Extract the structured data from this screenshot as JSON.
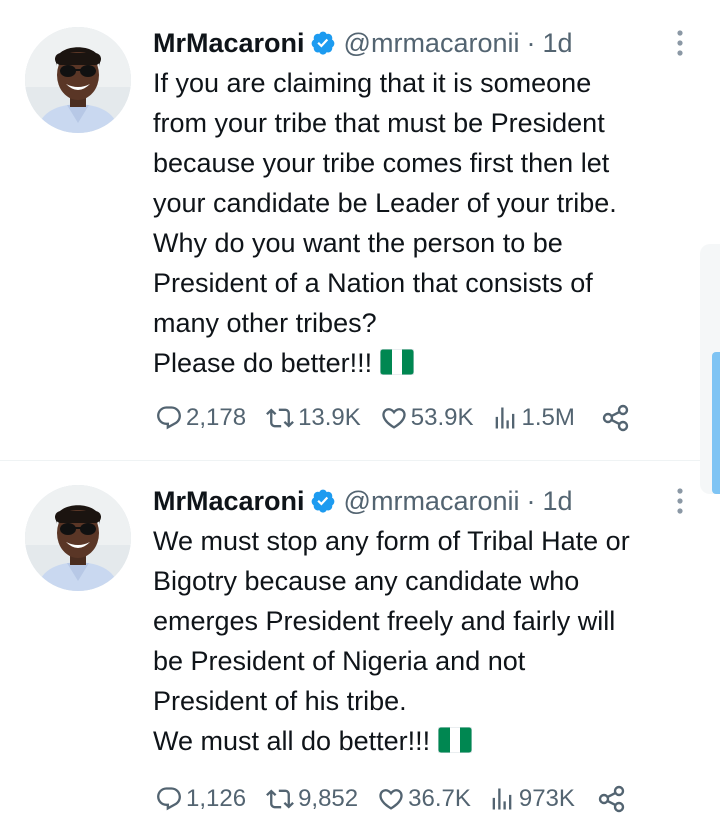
{
  "tweets": [
    {
      "author": {
        "name": "MrMacaroni",
        "handle": "@mrmacaronii",
        "time": "1d",
        "separator": "·"
      },
      "lines": [
        "If you are claiming that it is someone",
        "from your tribe that must be President",
        "because your tribe comes first then let",
        "your candidate be Leader of your tribe.",
        "Why do you want the person to be",
        "President of a Nation that consists of",
        "many other tribes?",
        "Please do better!!!"
      ],
      "stats": {
        "replies": "2,178",
        "retweets": "13.9K",
        "likes": "53.9K",
        "views": "1.5M"
      }
    },
    {
      "author": {
        "name": "MrMacaroni",
        "handle": "@mrmacaronii",
        "time": "1d",
        "separator": "·"
      },
      "lines": [
        "We must stop any form of Tribal Hate or",
        "Bigotry because any candidate who",
        "emerges President freely and fairly will",
        "be President of Nigeria and not",
        "President of his tribe.",
        "We must all do better!!!"
      ],
      "stats": {
        "replies": "1,126",
        "retweets": "9,852",
        "likes": "36.7K",
        "views": "973K"
      }
    }
  ],
  "icons": {
    "verified": "verified-badge-icon",
    "more": "more-vertical-icon",
    "reply": "reply-icon",
    "retweet": "retweet-icon",
    "like": "heart-icon",
    "views": "views-icon",
    "share": "share-icon",
    "flag": "nigeria-flag-emoji"
  },
  "colors": {
    "text": "#0f1419",
    "secondary": "#536471",
    "verified": "#1d9bf0",
    "divider": "#eff3f4",
    "flag_green": "#008751"
  }
}
